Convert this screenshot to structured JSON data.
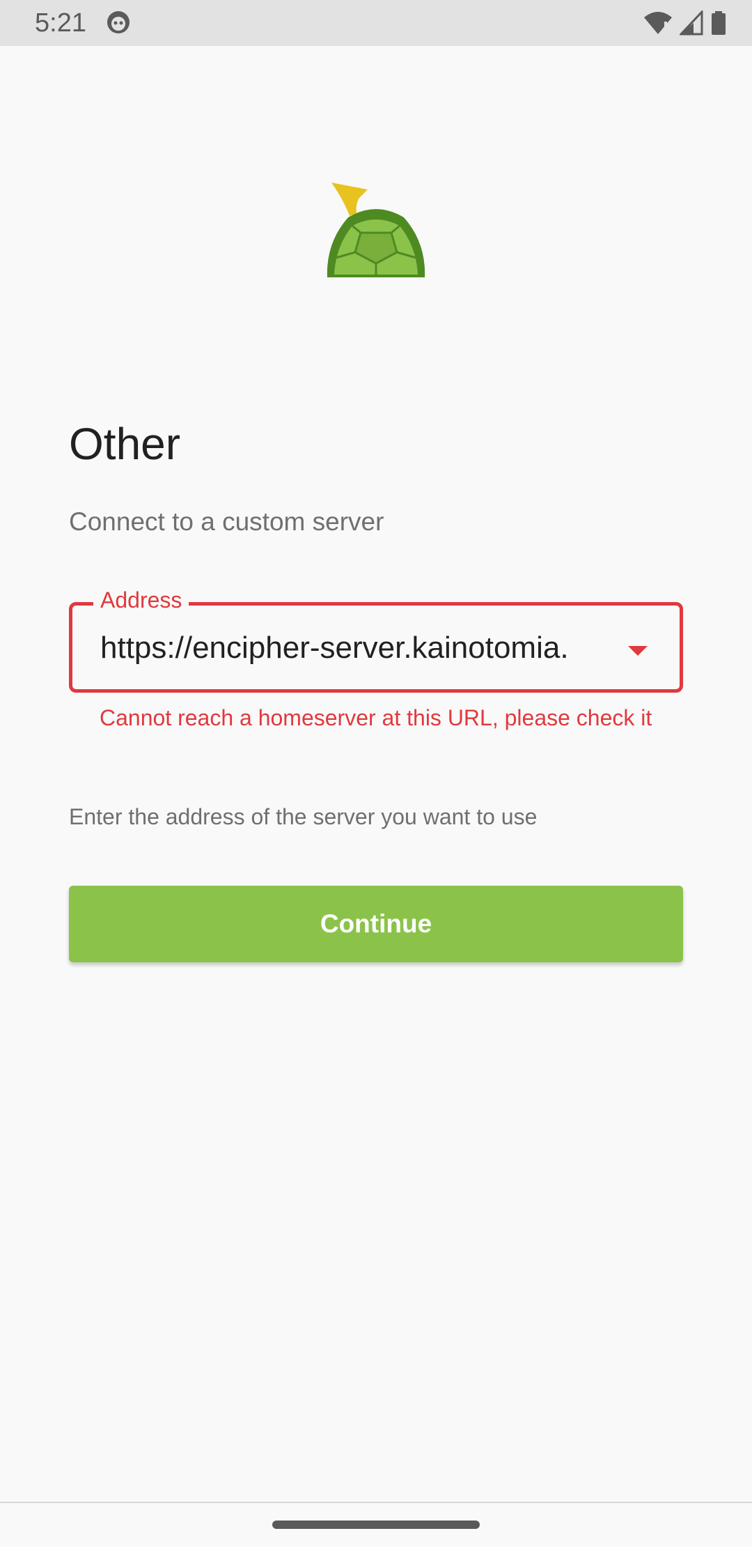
{
  "status_bar": {
    "time": "5:21",
    "icons": [
      "app-notification-icon",
      "wifi-icon",
      "signal-icon",
      "battery-icon"
    ]
  },
  "page": {
    "title": "Other",
    "subtitle": "Connect to a custom server"
  },
  "address_field": {
    "label": "Address",
    "value": "https://encipher-server.kainotomia.",
    "error": "Cannot reach a homeserver at this URL, please check it"
  },
  "hint": "Enter the address of the server you want to use",
  "continue_button": {
    "label": "Continue"
  },
  "colors": {
    "accent": "#8bc34a",
    "error": "#e0393e",
    "background": "#f9f9f9"
  }
}
